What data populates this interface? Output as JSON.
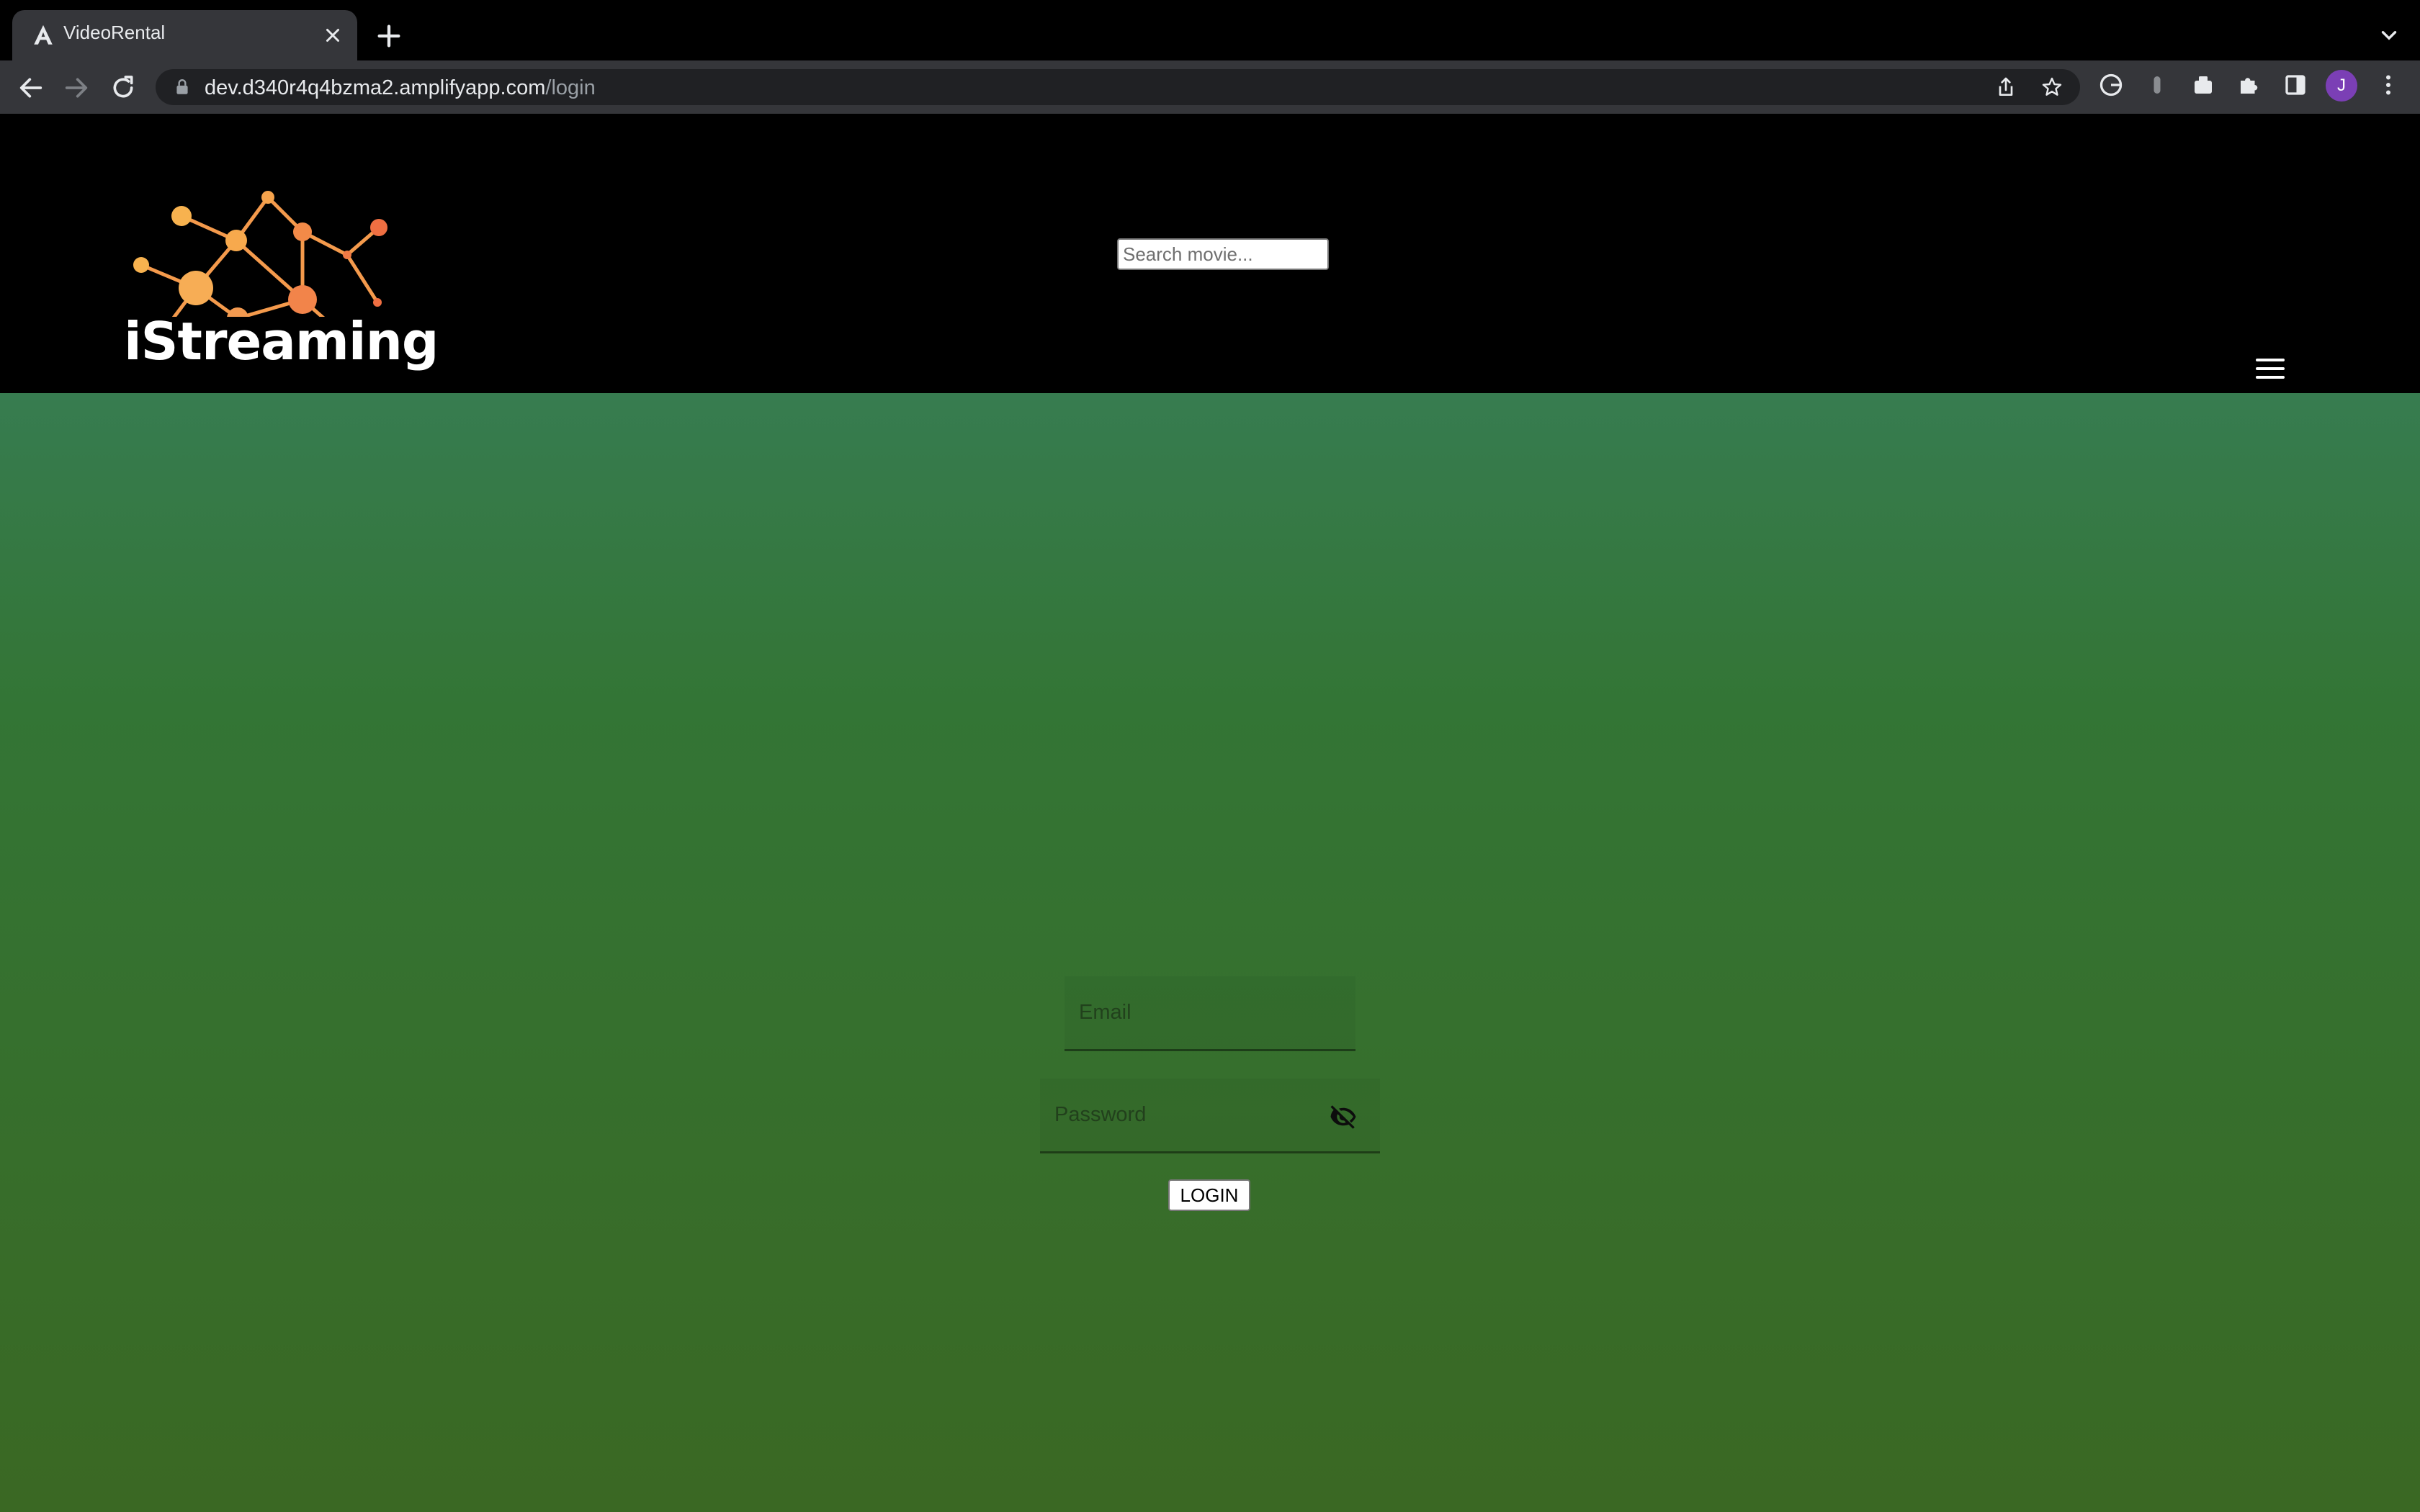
{
  "browser": {
    "tab": {
      "title": "VideoRental",
      "favicon": "angular-a-icon"
    },
    "address": {
      "host": "dev.d340r4q4bzma2.amplifyapp.com",
      "path": "/login"
    },
    "avatar_initial": "J"
  },
  "header": {
    "logo_text": "iStreaming",
    "search_placeholder": "Search movie..."
  },
  "login_form": {
    "email_placeholder": "Email",
    "password_placeholder": "Password",
    "login_label": "LOGIN"
  },
  "colors": {
    "header_bg": "#000000",
    "content_gradient_top": "#377c50",
    "content_gradient_bottom": "#3a6823",
    "logo_orange": "#f07a45",
    "logo_yellow": "#f7a94d"
  }
}
